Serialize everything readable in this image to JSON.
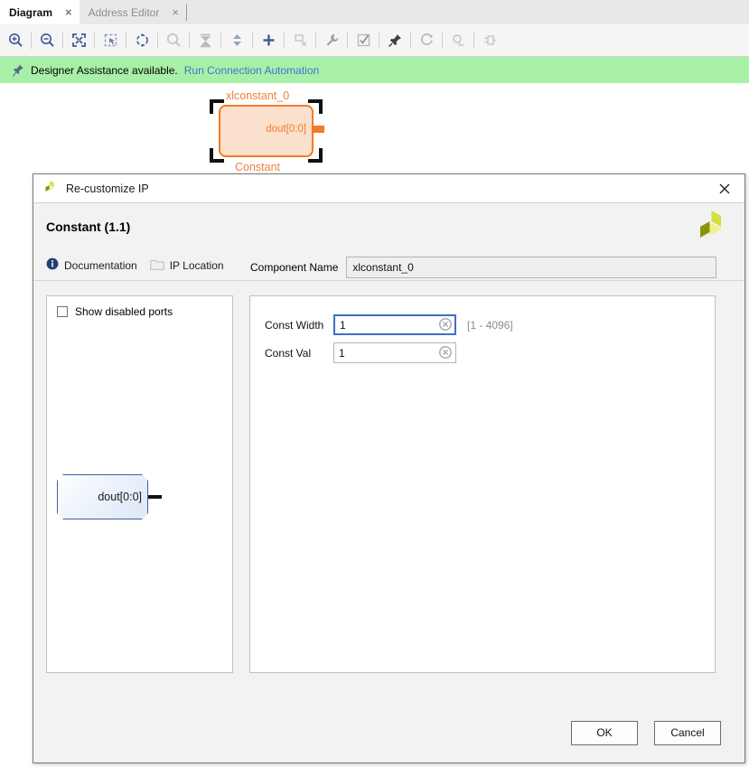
{
  "tabs": [
    {
      "label": "Diagram",
      "active": true,
      "close": "×"
    },
    {
      "label": "Address Editor",
      "active": false,
      "close": "×"
    }
  ],
  "toolbar": {
    "buttons": [
      {
        "name": "zoom-in-icon",
        "tooltip": "Zoom In"
      },
      {
        "name": "zoom-out-icon",
        "tooltip": "Zoom Out"
      },
      {
        "name": "zoom-fit-icon",
        "tooltip": "Zoom Fit"
      },
      {
        "name": "fit-selection-icon",
        "tooltip": "Fit Selection"
      },
      {
        "name": "optimize-routing-icon",
        "tooltip": "Optimize Routing"
      },
      {
        "name": "search-icon",
        "tooltip": "Search"
      },
      {
        "name": "collapse-all-icon",
        "tooltip": "Collapse All"
      },
      {
        "name": "expand-all-icon",
        "tooltip": "Expand All"
      },
      {
        "name": "add-ip-icon",
        "tooltip": "Add IP"
      },
      {
        "name": "add-module-icon",
        "tooltip": "Add Module"
      },
      {
        "name": "settings-wrench-icon",
        "tooltip": "Customize Block"
      },
      {
        "name": "validate-design-icon",
        "tooltip": "Validate Design"
      },
      {
        "name": "pin-icon",
        "tooltip": "Pin"
      },
      {
        "name": "refresh-icon",
        "tooltip": "Refresh"
      },
      {
        "name": "regenerate-layout-icon",
        "tooltip": "Regenerate Layout"
      },
      {
        "name": "create-port-icon",
        "tooltip": "Create Port"
      }
    ]
  },
  "assistance": {
    "icon": "pushpin-icon",
    "message": "Designer Assistance available.",
    "link": "Run Connection Automation"
  },
  "canvas": {
    "block": {
      "instance_name": "xlconstant_0",
      "type_name": "Constant",
      "port": "dout[0:0]",
      "fill_color": "#fbe0ce",
      "border_color": "#f07c28",
      "text_color": "#f08040",
      "selected": true
    }
  },
  "dialog": {
    "window_title": "Re-customize IP",
    "logo_icon": "xilinx-logo-icon",
    "close_icon": "close-icon",
    "heading": "Constant (1.1)",
    "links": [
      {
        "label": "Documentation",
        "icon": "info-icon"
      },
      {
        "label": "IP Location",
        "icon": "folder-icon"
      }
    ],
    "left_panel": {
      "show_disabled_ports": {
        "label": "Show disabled ports",
        "checked": false
      },
      "symbol": {
        "port_label": "dout[0:0]"
      }
    },
    "right_panel": {
      "component_name": {
        "label": "Component Name",
        "value": "xlconstant_0"
      },
      "fields": [
        {
          "label": "Const Width",
          "value": "1",
          "hint": "[1 - 4096]",
          "focused": true,
          "clear_icon": "clear-field-icon"
        },
        {
          "label": "Const Val",
          "value": "1",
          "hint": "",
          "focused": false,
          "clear_icon": "clear-field-icon"
        }
      ]
    },
    "footer": {
      "ok": "OK",
      "cancel": "Cancel"
    }
  },
  "colors": {
    "assist_bg": "#a8f0a8",
    "link_blue": "#3b76d0",
    "block_orange": "#f07c28",
    "focus_blue": "#3a72c4"
  }
}
